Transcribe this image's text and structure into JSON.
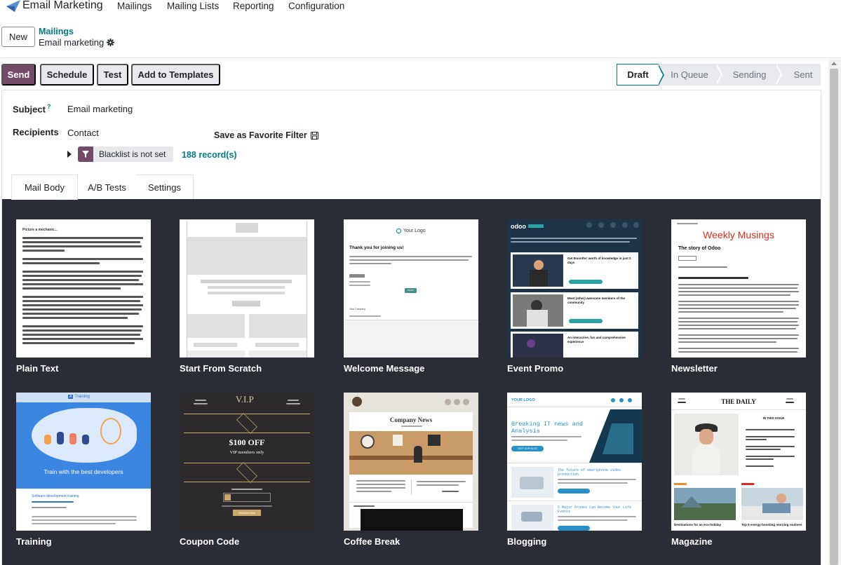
{
  "app": {
    "title": "Email Marketing",
    "menu": [
      "Mailings",
      "Mailing Lists",
      "Reporting",
      "Configuration"
    ],
    "accent": "#714b67",
    "link_color": "#017e84"
  },
  "breadcrumb": {
    "new_label": "New",
    "parent": "Mailings",
    "current": "Email marketing"
  },
  "actions": {
    "send": "Send",
    "schedule": "Schedule",
    "test": "Test",
    "add_to_templates": "Add to Templates"
  },
  "status": {
    "stages": [
      "Draft",
      "In Queue",
      "Sending",
      "Sent"
    ],
    "active": "Draft"
  },
  "form": {
    "subject_label": "Subject",
    "subject_help": "?",
    "subject_value": "Email marketing",
    "recipients_label": "Recipients",
    "recipients_value": "Contact",
    "save_favorite": "Save as Favorite Filter",
    "filter_chip": "Blacklist is not set",
    "records": "188 record(s)"
  },
  "tabs": [
    "Mail Body",
    "A/B Tests",
    "Settings"
  ],
  "templates": [
    {
      "label": "Plain Text",
      "icon": "plain-text-thumbnail"
    },
    {
      "label": "Start From Scratch",
      "icon": "scratch-thumbnail"
    },
    {
      "label": "Welcome Message",
      "icon": "welcome-thumbnail"
    },
    {
      "label": "Event Promo",
      "icon": "event-thumbnail"
    },
    {
      "label": "Newsletter",
      "icon": "newsletter-thumbnail"
    },
    {
      "label": "Training",
      "icon": "training-thumbnail"
    },
    {
      "label": "Coupon Code",
      "icon": "coupon-thumbnail"
    },
    {
      "label": "Coffee Break",
      "icon": "coffee-thumbnail"
    },
    {
      "label": "Blogging",
      "icon": "blogging-thumbnail"
    },
    {
      "label": "Magazine",
      "icon": "magazine-thumbnail"
    }
  ],
  "thumb_text": {
    "plain_heading": "Picture a mechanic...",
    "welcome_logo": "Your Logo",
    "welcome_title": "Thank you for joining us!",
    "welcome_company": "Your Company",
    "welcome_button": "START",
    "event_brand": "odoo",
    "event_card1": "Get 8months' worth of knowledge in just 2 days",
    "event_card2": "Meet (other) awesome members of the community",
    "event_card3": "An interactive, fun and comprehensive experience",
    "newsletter_title": "Weekly Musings",
    "newsletter_sub": "The story of Odoo",
    "training_brand": "Training",
    "training_banner": "Train with the best developers",
    "training_session": "Software development training",
    "coupon_vip": "V.I.P",
    "coupon_offer": "$100 OFF",
    "coupon_members": "VIP members only",
    "coupon_cta": "Redeem Now",
    "coffee_title": "Company News",
    "blog_logo": "YOUR LOGO",
    "blog_title": "Breaking IT news and Analysis",
    "blog_button": "VISIT OUR BLOG",
    "blog_article1": "The future of smartphone video production",
    "blog_article2": "5 Major Drones Can Become Your Life Events",
    "mag_title": "THE DAILY",
    "mag_issue": "IN THIS ISSUE",
    "mag_caption1": "Destinations for an eco-holiday",
    "mag_caption2": "Top 5 energy-boosting morning routines"
  }
}
